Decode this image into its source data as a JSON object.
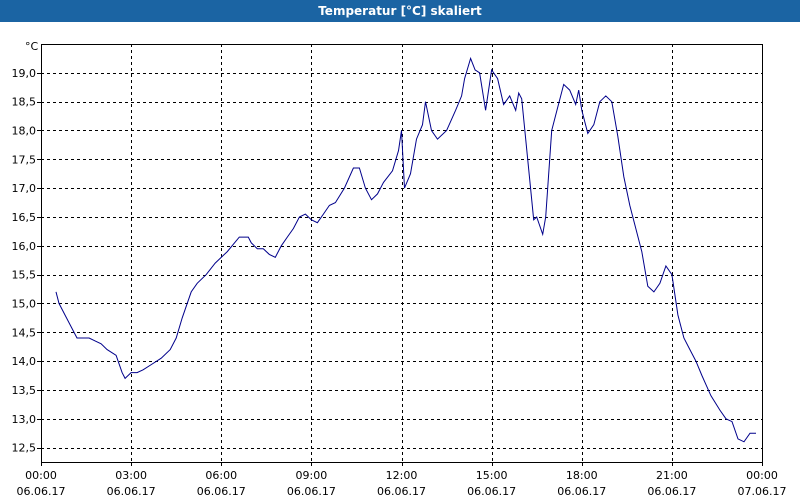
{
  "window": {
    "title": "Temperatur [°C] skaliert",
    "title_bg": "#1b64a3"
  },
  "chart_data": {
    "type": "line",
    "title": "Temperatur [°C] skaliert",
    "ylabel": "°C",
    "xlabel": "",
    "ylim": [
      12.25,
      19.5
    ],
    "xlim": [
      0,
      24
    ],
    "grid": true,
    "yticks": [
      "12,5",
      "13,0",
      "13,5",
      "14,0",
      "14,5",
      "15,0",
      "15,5",
      "16,0",
      "16,5",
      "17,0",
      "17,5",
      "18,0",
      "18,5",
      "19,0"
    ],
    "ytick_values": [
      12.5,
      13.0,
      13.5,
      14.0,
      14.5,
      15.0,
      15.5,
      16.0,
      16.5,
      17.0,
      17.5,
      18.0,
      18.5,
      19.0
    ],
    "xticks": [
      {
        "time": "00:00",
        "date": "06.06.17",
        "hour": 0
      },
      {
        "time": "03:00",
        "date": "06.06.17",
        "hour": 3
      },
      {
        "time": "06:00",
        "date": "06.06.17",
        "hour": 6
      },
      {
        "time": "09:00",
        "date": "06.06.17",
        "hour": 9
      },
      {
        "time": "12:00",
        "date": "06.06.17",
        "hour": 12
      },
      {
        "time": "15:00",
        "date": "06.06.17",
        "hour": 15
      },
      {
        "time": "18:00",
        "date": "06.06.17",
        "hour": 18
      },
      {
        "time": "21:00",
        "date": "06.06.17",
        "hour": 21
      },
      {
        "time": "00:00",
        "date": "07.06.17",
        "hour": 24
      }
    ],
    "series": [
      {
        "color": "#00008b",
        "x": [
          0.5,
          0.6,
          0.8,
          1.0,
          1.2,
          1.4,
          1.6,
          1.8,
          2.0,
          2.2,
          2.5,
          2.7,
          2.8,
          3.0,
          3.2,
          3.4,
          3.7,
          4.0,
          4.3,
          4.5,
          4.7,
          4.9,
          5.0,
          5.2,
          5.5,
          5.8,
          6.2,
          6.6,
          6.9,
          7.0,
          7.2,
          7.4,
          7.6,
          7.8,
          8.0,
          8.2,
          8.4,
          8.6,
          8.8,
          9.0,
          9.2,
          9.4,
          9.6,
          9.8,
          10.1,
          10.4,
          10.6,
          10.8,
          11.0,
          11.2,
          11.4,
          11.7,
          11.9,
          12.0,
          12.1,
          12.3,
          12.5,
          12.7,
          12.8,
          13.0,
          13.2,
          13.5,
          13.8,
          14.0,
          14.1,
          14.3,
          14.45,
          14.6,
          14.8,
          15.0,
          15.2,
          15.4,
          15.6,
          15.8,
          15.9,
          16.0,
          16.2,
          16.4,
          16.5,
          16.7,
          16.8,
          17.0,
          17.2,
          17.4,
          17.6,
          17.8,
          17.9,
          18.0,
          18.2,
          18.4,
          18.6,
          18.8,
          19.0,
          19.2,
          19.4,
          19.6,
          19.8,
          20.0,
          20.2,
          20.4,
          20.6,
          20.8,
          21.0,
          21.2,
          21.4,
          21.6,
          21.8,
          22.0,
          22.3,
          22.6,
          22.8,
          23.0,
          23.2,
          23.4,
          23.6,
          23.8
        ],
        "y": [
          15.2,
          15.0,
          14.8,
          14.6,
          14.4,
          14.4,
          14.4,
          14.35,
          14.3,
          14.2,
          14.1,
          13.8,
          13.7,
          13.8,
          13.8,
          13.85,
          13.95,
          14.05,
          14.2,
          14.4,
          14.75,
          15.05,
          15.2,
          15.35,
          15.5,
          15.7,
          15.9,
          16.15,
          16.15,
          16.05,
          15.95,
          15.95,
          15.85,
          15.8,
          16.0,
          16.15,
          16.3,
          16.5,
          16.55,
          16.45,
          16.4,
          16.55,
          16.7,
          16.75,
          17.0,
          17.35,
          17.35,
          17.0,
          16.8,
          16.9,
          17.1,
          17.3,
          17.65,
          18.0,
          17.0,
          17.25,
          17.85,
          18.1,
          18.5,
          18.0,
          17.85,
          18.0,
          18.35,
          18.6,
          18.9,
          19.25,
          19.05,
          19.0,
          18.35,
          19.05,
          18.9,
          18.45,
          18.6,
          18.35,
          18.65,
          18.55,
          17.5,
          16.45,
          16.5,
          16.2,
          16.5,
          18.0,
          18.4,
          18.8,
          18.7,
          18.45,
          18.7,
          18.35,
          17.95,
          18.1,
          18.5,
          18.6,
          18.5,
          17.9,
          17.2,
          16.7,
          16.3,
          15.9,
          15.3,
          15.2,
          15.35,
          15.65,
          15.5,
          14.8,
          14.4,
          14.2,
          14.0,
          13.75,
          13.4,
          13.15,
          13.0,
          12.95,
          12.65,
          12.6,
          12.75,
          12.75
        ]
      }
    ]
  }
}
